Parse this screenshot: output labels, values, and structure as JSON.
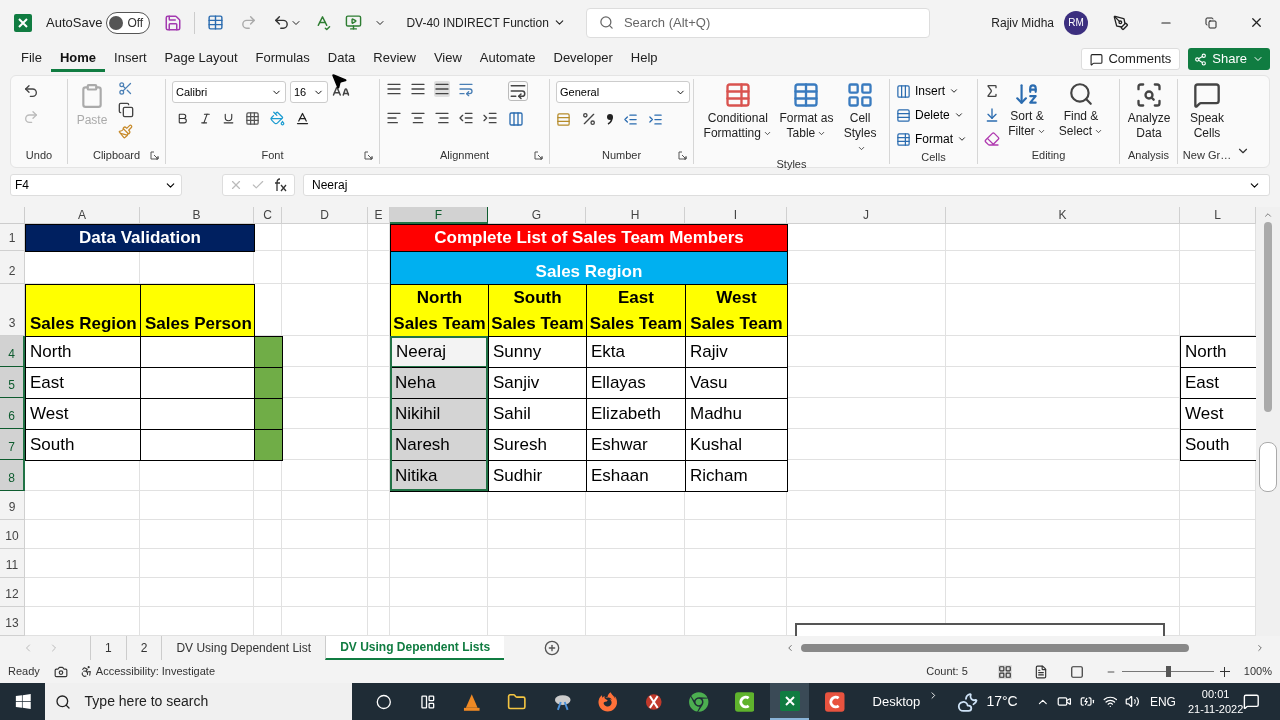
{
  "title_bar": {
    "autosave_label": "AutoSave",
    "autosave_state": "Off",
    "autosave_on": false,
    "document_title": "DV-40 INDIRECT Function",
    "search_placeholder": "Search (Alt+Q)",
    "user_name": "Rajiv Midha",
    "user_initials": "RM"
  },
  "menu_tabs": [
    {
      "label": "File",
      "selected": false
    },
    {
      "label": "Home",
      "selected": true
    },
    {
      "label": "Insert",
      "selected": false
    },
    {
      "label": "Page Layout",
      "selected": false
    },
    {
      "label": "Formulas",
      "selected": false
    },
    {
      "label": "Data",
      "selected": false
    },
    {
      "label": "Review",
      "selected": false
    },
    {
      "label": "View",
      "selected": false
    },
    {
      "label": "Automate",
      "selected": false
    },
    {
      "label": "Developer",
      "selected": false
    },
    {
      "label": "Help",
      "selected": false
    }
  ],
  "comments_button": "Comments",
  "share_button": "Share",
  "ribbon": {
    "undo": {
      "label": "Undo"
    },
    "clipboard": {
      "label": "Clipboard",
      "paste": "Paste"
    },
    "font": {
      "label": "Font",
      "font_name": "Calibri",
      "font_size": "16"
    },
    "alignment": {
      "label": "Alignment"
    },
    "number": {
      "label": "Number",
      "format": "General"
    },
    "styles": {
      "label": "Styles",
      "buttons": [
        "Conditional Formatting",
        "Format as Table",
        "Cell Styles"
      ]
    },
    "cells": {
      "label": "Cells",
      "buttons": [
        "Insert",
        "Delete",
        "Format"
      ]
    },
    "editing": {
      "label": "Editing",
      "buttons": [
        "Sort & Filter",
        "Find & Select"
      ]
    },
    "analysis": {
      "label": "Analysis",
      "button": "Analyze Data"
    },
    "new_group": {
      "label": "New Gr…",
      "button": "Speak Cells"
    }
  },
  "formula_bar": {
    "name_box": "F4",
    "formula": "Neeraj"
  },
  "column_headers": [
    {
      "label": "A",
      "selected": false
    },
    {
      "label": "B",
      "selected": false
    },
    {
      "label": "C",
      "selected": false
    },
    {
      "label": "D",
      "selected": false
    },
    {
      "label": "E",
      "selected": false
    },
    {
      "label": "F",
      "selected": true
    },
    {
      "label": "G",
      "selected": false
    },
    {
      "label": "H",
      "selected": false
    },
    {
      "label": "I",
      "selected": false
    },
    {
      "label": "J",
      "selected": false
    },
    {
      "label": "K",
      "selected": false
    },
    {
      "label": "L",
      "selected": false
    }
  ],
  "row_headers": [
    {
      "label": "1",
      "selected": false
    },
    {
      "label": "2",
      "selected": false
    },
    {
      "label": "3",
      "selected": false
    },
    {
      "label": "4",
      "selected": true
    },
    {
      "label": "5",
      "selected": true
    },
    {
      "label": "6",
      "selected": true
    },
    {
      "label": "7",
      "selected": true
    },
    {
      "label": "8",
      "selected": true
    },
    {
      "label": "9",
      "selected": false
    },
    {
      "label": "10",
      "selected": false
    },
    {
      "label": "11",
      "selected": false
    },
    {
      "label": "12",
      "selected": false
    },
    {
      "label": "13",
      "selected": false
    }
  ],
  "validation_table": {
    "title": "Data Validation",
    "headers": [
      "Sales Region",
      "Sales Person"
    ],
    "regions": [
      "North",
      "East",
      "West",
      "South"
    ]
  },
  "team_table": {
    "title": "Complete List of Sales Team Members",
    "subtitle": "Sales Region",
    "headers": [
      [
        "North",
        "Sales Team"
      ],
      [
        "South",
        "Sales Team"
      ],
      [
        "East",
        "Sales Team"
      ],
      [
        "West",
        "Sales Team"
      ]
    ],
    "rows": [
      {
        "cells": [
          {
            "text": "Neeraj",
            "selected": true,
            "active": true
          },
          {
            "text": "Sunny",
            "selected": false,
            "active": false
          },
          {
            "text": "Ekta",
            "selected": false,
            "active": false
          },
          {
            "text": "Rajiv",
            "selected": false,
            "active": false
          }
        ]
      },
      {
        "cells": [
          {
            "text": "Neha",
            "selected": true,
            "active": false
          },
          {
            "text": "Sanjiv",
            "selected": false,
            "active": false
          },
          {
            "text": "Ellayas",
            "selected": false,
            "active": false
          },
          {
            "text": "Vasu",
            "selected": false,
            "active": false
          }
        ]
      },
      {
        "cells": [
          {
            "text": "Nikihil",
            "selected": true,
            "active": false
          },
          {
            "text": "Sahil",
            "selected": false,
            "active": false
          },
          {
            "text": "Elizabeth",
            "selected": false,
            "active": false
          },
          {
            "text": "Madhu",
            "selected": false,
            "active": false
          }
        ]
      },
      {
        "cells": [
          {
            "text": "Naresh",
            "selected": true,
            "active": false
          },
          {
            "text": "Suresh",
            "selected": false,
            "active": false
          },
          {
            "text": "Eshwar",
            "selected": false,
            "active": false
          },
          {
            "text": "Kushal",
            "selected": false,
            "active": false
          }
        ]
      },
      {
        "cells": [
          {
            "text": "Nitika",
            "selected": true,
            "active": false
          },
          {
            "text": "Sudhir",
            "selected": false,
            "active": false
          },
          {
            "text": "Eshaan",
            "selected": false,
            "active": false
          },
          {
            "text": "Richam",
            "selected": false,
            "active": false
          }
        ]
      }
    ]
  },
  "region_list": [
    "North",
    "East",
    "West",
    "South"
  ],
  "sheet_tabs": [
    {
      "label": "1",
      "selected": false
    },
    {
      "label": "2",
      "selected": false
    },
    {
      "label": "DV Using Dependent List",
      "selected": false
    },
    {
      "label": "DV Using Dependent Lists",
      "selected": true
    }
  ],
  "status_bar": {
    "mode": "Ready",
    "accessibility": "Accessibility: Investigate",
    "count": "Count: 5",
    "zoom": "100%",
    "zoom_slider": {
      "level": 0.5
    }
  },
  "taskbar": {
    "search_placeholder": "Type here to search",
    "desktop": "Desktop",
    "temperature": "17°C",
    "language": "ENG",
    "time": "00:01",
    "date": "21-11-2022"
  }
}
